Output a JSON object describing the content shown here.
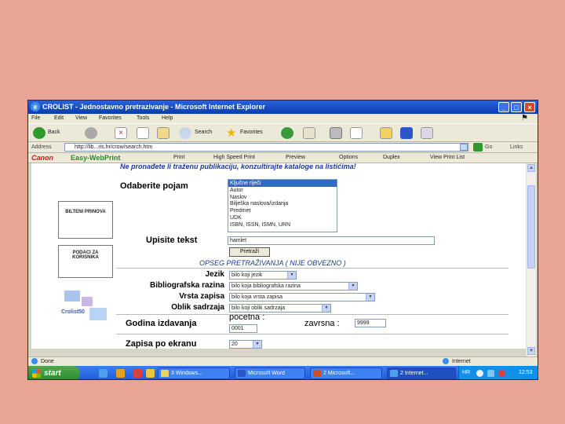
{
  "window": {
    "title": "CROLIST - Jednostavno pretrazivanje - Microsoft Internet Explorer",
    "menu": [
      "File",
      "Edit",
      "View",
      "Favorites",
      "Tools",
      "Help"
    ]
  },
  "toolbar": {
    "back": "Back",
    "search": "Search",
    "favorites": "Favorites"
  },
  "address": {
    "label": "Address",
    "url": "http://lib...ris.hr/crow/search.htm",
    "go": "Go",
    "links": "Links"
  },
  "canon": {
    "brand": "Canon",
    "product": "Easy-WebPrint",
    "items": [
      "Print",
      "High Speed Print",
      "Preview",
      "Options",
      "Duplex",
      "View Print List"
    ]
  },
  "page": {
    "notice": "Ne pronađete li traženu publikaciju, konzultirajte kataloge na listićima!",
    "side": {
      "bilteni": "BILTENI PRINOVA",
      "podaci": "PODACI ZA KORISNIKA",
      "logo": "Crolist50"
    },
    "odaberite_label": "Odaberite pojam",
    "listbox_items": [
      "Ključne riječi",
      "Autor",
      "Naslov",
      "Bilješka naslova/izdanja",
      "Predmet",
      "UDK",
      "ISBN, ISSN, ISMN, URN"
    ],
    "upisite_label": "Upisite tekst",
    "upisite_value": "hamlet",
    "pretrazi": "Pretraži",
    "opseg": "OPSEG PRETRAŽIVANJA   ( NIJE OBVEZNO )",
    "filters": [
      {
        "label": "Jezik",
        "value": "bilo koji jezik"
      },
      {
        "label": "Bibliografska razina",
        "value": "bilo koja bibliografska razina"
      },
      {
        "label": "Vrsta zapisa",
        "value": "bilo koja vrsta zapisa"
      },
      {
        "label": "Oblik sadrzaja",
        "value": "bilo koji oblik sadrzaja"
      }
    ],
    "godina_label": "Godina izdavanja",
    "pocetna_label": "pocetna :",
    "pocetna_value": "0001",
    "zavrsna_label": "zavrsna :",
    "zavrsna_value": "9999",
    "zapisa_label": "Zapisa po ekranu",
    "zapisa_value": "20"
  },
  "status": {
    "left": "Done",
    "zone": "Internet"
  },
  "taskbar": {
    "start": "start",
    "tasks": [
      "3 Windows...",
      "Microsoft Word",
      "2 Microsoft...",
      "2 Internet..."
    ],
    "lang": "HR",
    "clock": "12:53"
  }
}
